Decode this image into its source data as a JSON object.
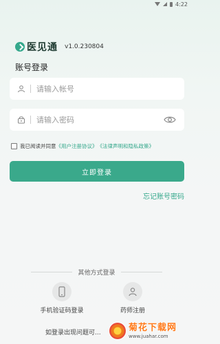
{
  "status_bar": {
    "time": "4:22"
  },
  "brand": {
    "name": "医见通",
    "version": "v1.0.230804"
  },
  "login": {
    "section_title": "账号登录",
    "account_placeholder": "请输入帐号",
    "password_placeholder": "请输入密码",
    "agree_prefix": "我已阅读并同意",
    "user_agreement": "《用户注册协议》",
    "legal_policy": "《法律声明和隐私政策》",
    "login_button": "立即登录",
    "forgot_password": "忘记账号密码"
  },
  "other_methods": {
    "title": "其他方式登录",
    "phone_login": "手机验证码登录",
    "pharmacist_register": "药师注册"
  },
  "footer": {
    "help_text": "如登录出现问题可..."
  },
  "watermark": {
    "title": "菊花下载网",
    "url": "www.juahar.com"
  },
  "colors": {
    "accent": "#3aa98b",
    "link": "#35a88c",
    "background_top": "#e9f3ef",
    "background_bottom": "#f5f6f6"
  },
  "icons": {
    "account": "user-icon",
    "password": "lock-icon",
    "visibility": "eye-icon",
    "phone": "phone-icon",
    "pharmacist": "person-icon"
  }
}
